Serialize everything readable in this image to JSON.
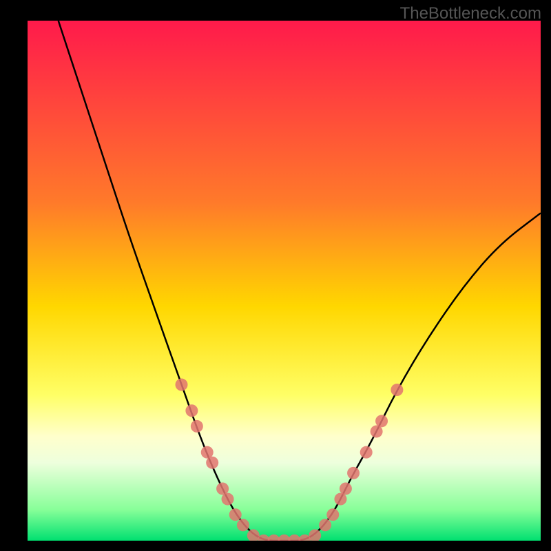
{
  "watermark": "TheBottleneck.com",
  "chart_data": {
    "type": "line",
    "title": "",
    "xlabel": "",
    "ylabel": "",
    "xlim": [
      0,
      100
    ],
    "ylim": [
      0,
      100
    ],
    "gradient_stops": [
      {
        "offset": 0,
        "color": "#ff1a4b"
      },
      {
        "offset": 35,
        "color": "#ff7a2a"
      },
      {
        "offset": 55,
        "color": "#ffd700"
      },
      {
        "offset": 72,
        "color": "#ffff66"
      },
      {
        "offset": 80,
        "color": "#ffffcc"
      },
      {
        "offset": 85,
        "color": "#eeffdd"
      },
      {
        "offset": 94,
        "color": "#88ff99"
      },
      {
        "offset": 100,
        "color": "#00e070"
      }
    ],
    "series": [
      {
        "name": "curve",
        "type": "line",
        "points": [
          {
            "x": 6,
            "y": 100
          },
          {
            "x": 10,
            "y": 88
          },
          {
            "x": 15,
            "y": 73
          },
          {
            "x": 20,
            "y": 58
          },
          {
            "x": 25,
            "y": 44
          },
          {
            "x": 30,
            "y": 30
          },
          {
            "x": 34,
            "y": 19
          },
          {
            "x": 37,
            "y": 12
          },
          {
            "x": 40,
            "y": 6
          },
          {
            "x": 43,
            "y": 2
          },
          {
            "x": 46,
            "y": 0
          },
          {
            "x": 50,
            "y": 0
          },
          {
            "x": 54,
            "y": 0
          },
          {
            "x": 57,
            "y": 2
          },
          {
            "x": 60,
            "y": 6
          },
          {
            "x": 63,
            "y": 12
          },
          {
            "x": 67,
            "y": 19
          },
          {
            "x": 72,
            "y": 29
          },
          {
            "x": 78,
            "y": 39
          },
          {
            "x": 85,
            "y": 49
          },
          {
            "x": 92,
            "y": 57
          },
          {
            "x": 100,
            "y": 63
          }
        ]
      },
      {
        "name": "datapoints-left",
        "type": "scatter",
        "color": "#e2746f",
        "points": [
          {
            "x": 30,
            "y": 30
          },
          {
            "x": 32,
            "y": 25
          },
          {
            "x": 33,
            "y": 22
          },
          {
            "x": 35,
            "y": 17
          },
          {
            "x": 36,
            "y": 15
          },
          {
            "x": 38,
            "y": 10
          },
          {
            "x": 39,
            "y": 8
          },
          {
            "x": 40.5,
            "y": 5
          },
          {
            "x": 42,
            "y": 3
          }
        ]
      },
      {
        "name": "datapoints-bottom",
        "type": "scatter",
        "color": "#e2746f",
        "points": [
          {
            "x": 44,
            "y": 1
          },
          {
            "x": 46,
            "y": 0
          },
          {
            "x": 48,
            "y": 0
          },
          {
            "x": 50,
            "y": 0
          },
          {
            "x": 52,
            "y": 0
          },
          {
            "x": 54,
            "y": 0
          },
          {
            "x": 56,
            "y": 1
          }
        ]
      },
      {
        "name": "datapoints-right",
        "type": "scatter",
        "color": "#e2746f",
        "points": [
          {
            "x": 58,
            "y": 3
          },
          {
            "x": 59.5,
            "y": 5
          },
          {
            "x": 61,
            "y": 8
          },
          {
            "x": 62,
            "y": 10
          },
          {
            "x": 63.5,
            "y": 13
          },
          {
            "x": 66,
            "y": 17
          },
          {
            "x": 68,
            "y": 21
          },
          {
            "x": 69,
            "y": 23
          },
          {
            "x": 72,
            "y": 29
          }
        ]
      }
    ]
  }
}
